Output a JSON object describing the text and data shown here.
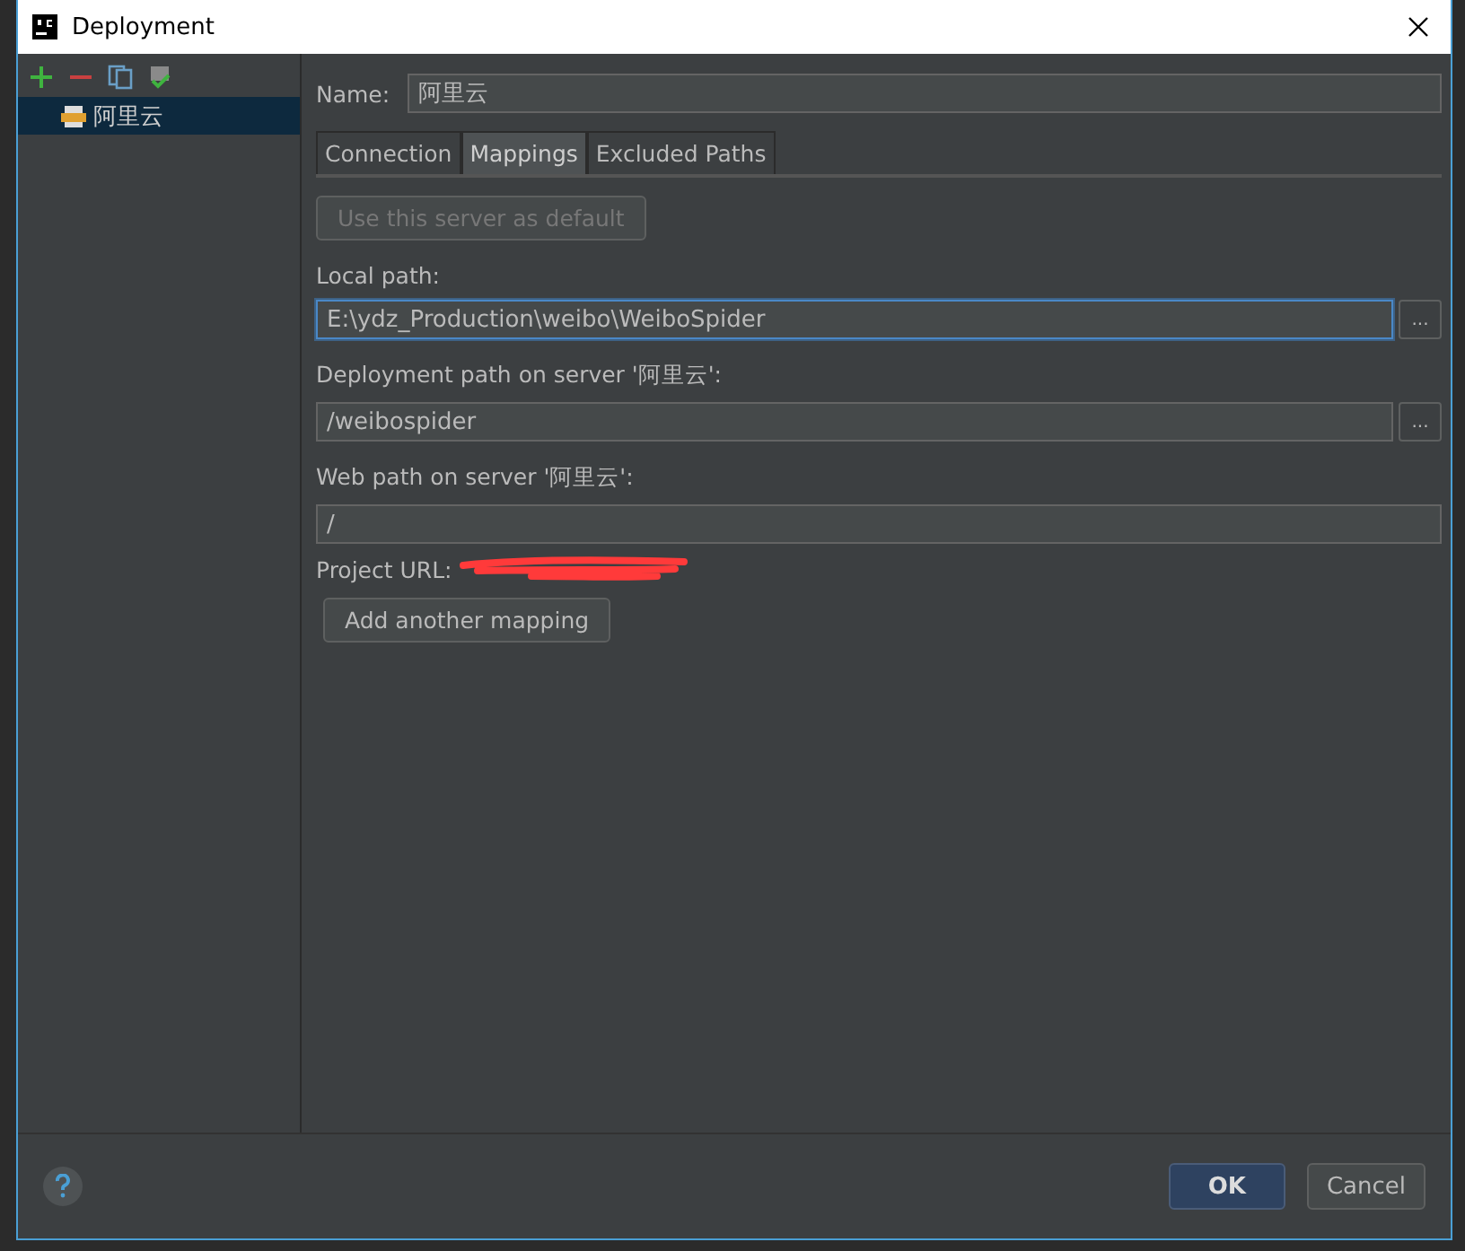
{
  "window": {
    "title": "Deployment"
  },
  "servers": [
    {
      "name": "阿里云",
      "selected": true
    }
  ],
  "name_field": {
    "label": "Name:",
    "value": "阿里云"
  },
  "tabs": [
    {
      "label": "Connection",
      "selected": false
    },
    {
      "label": "Mappings",
      "selected": true
    },
    {
      "label": "Excluded Paths",
      "selected": false
    }
  ],
  "default_button": {
    "label": "Use this server as default",
    "disabled": true
  },
  "mappings": [
    {
      "label": "Local path:",
      "value": "E:\\ydz_Production\\weibo\\WeiboSpider",
      "focused": true,
      "browse": "..."
    },
    {
      "label": "Deployment path on server '阿里云':",
      "value": "/weibospider",
      "focused": false,
      "browse": "..."
    },
    {
      "label": "Web path on server '阿里云':",
      "value": "/",
      "focused": false
    }
  ],
  "project_url": {
    "label": "Project URL:"
  },
  "add_button": {
    "label": "Add another mapping"
  },
  "buttons": [
    {
      "label": "OK",
      "kind": "primary"
    },
    {
      "label": "Cancel",
      "kind": "secondary"
    }
  ]
}
